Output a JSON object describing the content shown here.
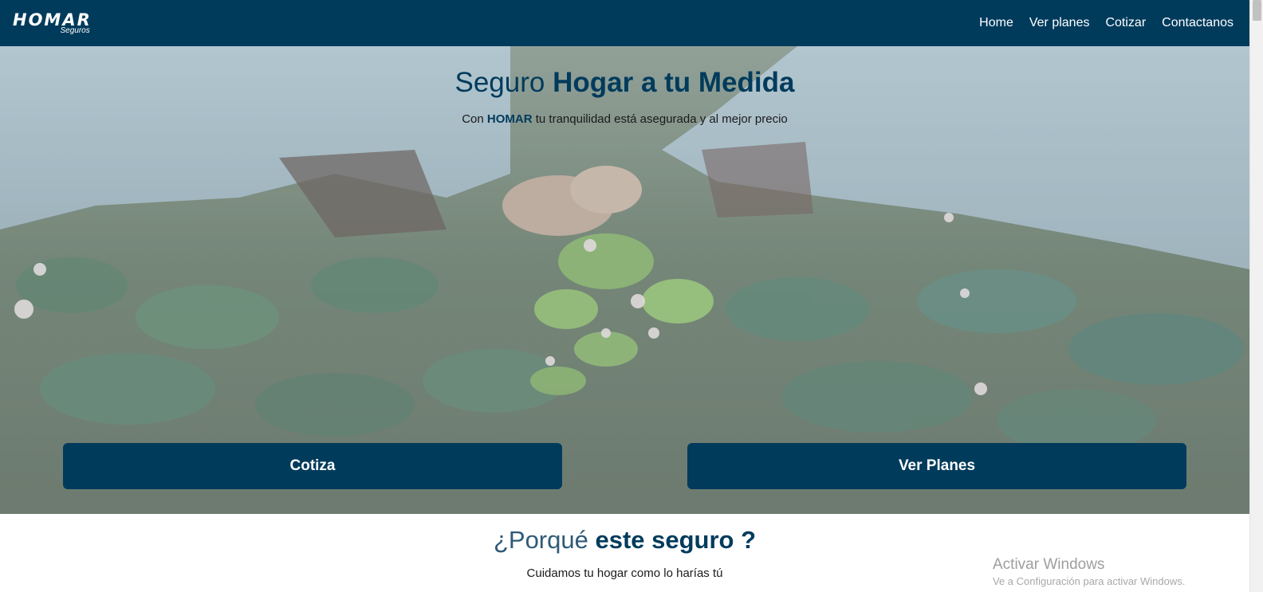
{
  "navbar": {
    "logo_main": "HOMAR",
    "logo_sub": "Seguros",
    "links": [
      "Home",
      "Ver planes",
      "Cotizar",
      "Contactanos"
    ]
  },
  "hero": {
    "title_light": "Seguro",
    "title_bold": "Hogar a tu Medida",
    "subtitle_prefix": "Con",
    "subtitle_brand": "HOMAR",
    "subtitle_rest": "tu tranquilidad está asegurada y al mejor precio",
    "button_cotiza": "Cotiza",
    "button_planes": "Ver Planes"
  },
  "why": {
    "title_light": "¿Porqué",
    "title_bold": "este seguro ?",
    "subtitle": "Cuidamos tu hogar como lo harías tú"
  },
  "watermark": {
    "title": "Activar Windows",
    "subtitle": "Ve a Configuración para activar Windows."
  },
  "colors": {
    "brand": "#003b5c",
    "white": "#ffffff"
  }
}
